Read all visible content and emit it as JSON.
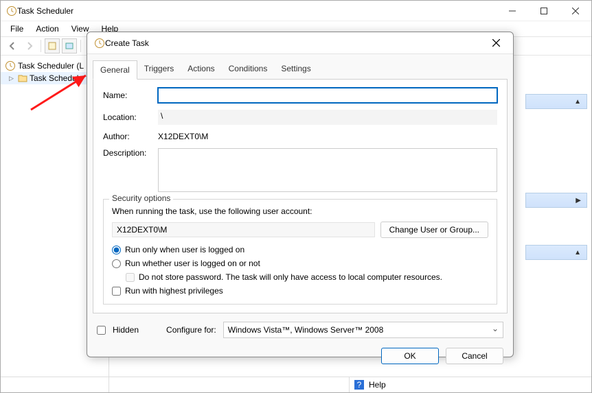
{
  "main": {
    "title": "Task Scheduler",
    "menubar": {
      "file": "File",
      "action": "Action",
      "view": "View",
      "help": "Help"
    },
    "tree": {
      "root": "Task Scheduler (L",
      "child": "Task Schedule"
    },
    "help": "Help"
  },
  "dialog": {
    "title": "Create Task",
    "tabs": {
      "general": "General",
      "triggers": "Triggers",
      "actions": "Actions",
      "conditions": "Conditions",
      "settings": "Settings"
    },
    "labels": {
      "name": "Name:",
      "location": "Location:",
      "author": "Author:",
      "description": "Description:"
    },
    "values": {
      "name": "",
      "location": "\\",
      "author": "X12DEXT0\\M",
      "description": ""
    },
    "security": {
      "legend": "Security options",
      "subtitle": "When running the task, use the following user account:",
      "account": "X12DEXT0\\M",
      "change_btn": "Change User or Group...",
      "opt_logged_on": "Run only when user is logged on",
      "opt_logged_or_not": "Run whether user is logged on or not",
      "opt_no_store": "Do not store password.  The task will only have access to local computer resources.",
      "opt_highest": "Run with highest privileges"
    },
    "bottom": {
      "hidden": "Hidden",
      "configure_label": "Configure for:",
      "configure_value": "Windows Vista™, Windows Server™ 2008"
    },
    "actions": {
      "ok": "OK",
      "cancel": "Cancel"
    }
  }
}
